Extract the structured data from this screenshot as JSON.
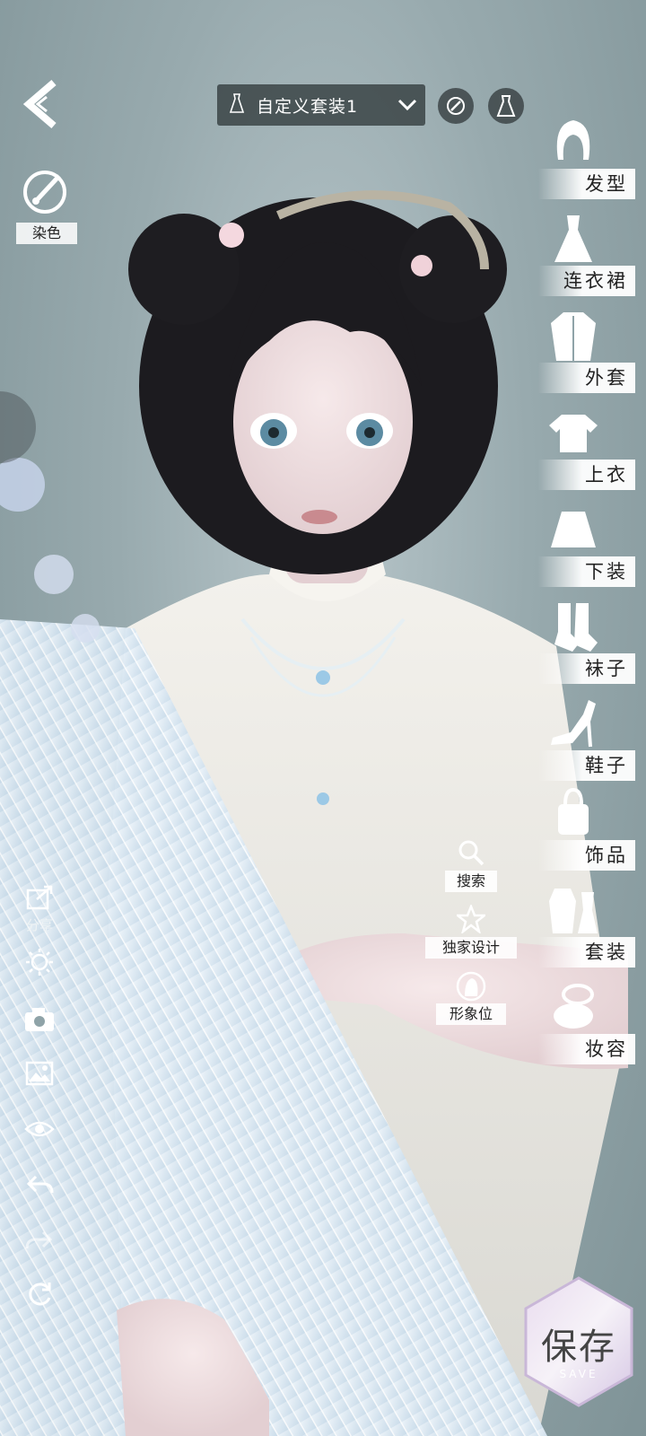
{
  "header": {
    "outfit_name": "自定义套装1"
  },
  "left_panel": {
    "dye_label": "染色",
    "share_label": "分享"
  },
  "right_categories": [
    {
      "label": "发型",
      "icon": "hairstyle-icon"
    },
    {
      "label": "连衣裙",
      "icon": "dress-icon"
    },
    {
      "label": "外套",
      "icon": "coat-icon"
    },
    {
      "label": "上衣",
      "icon": "top-icon"
    },
    {
      "label": "下装",
      "icon": "skirt-icon"
    },
    {
      "label": "袜子",
      "icon": "socks-icon"
    },
    {
      "label": "鞋子",
      "icon": "shoe-icon"
    },
    {
      "label": "饰品",
      "icon": "accessory-icon"
    },
    {
      "label": "套装",
      "icon": "outfit-set-icon"
    },
    {
      "label": "妆容",
      "icon": "makeup-icon"
    }
  ],
  "quick_actions": {
    "search_label": "搜索",
    "exclusive_label": "独家设计",
    "image_slot_label": "形象位"
  },
  "save": {
    "label": "保存",
    "sub_label": "SAVE"
  },
  "colors": {
    "background": "#98aaae",
    "panel_dark": "#283032",
    "label_bg": "#ffffff",
    "text_dark": "#222222"
  }
}
